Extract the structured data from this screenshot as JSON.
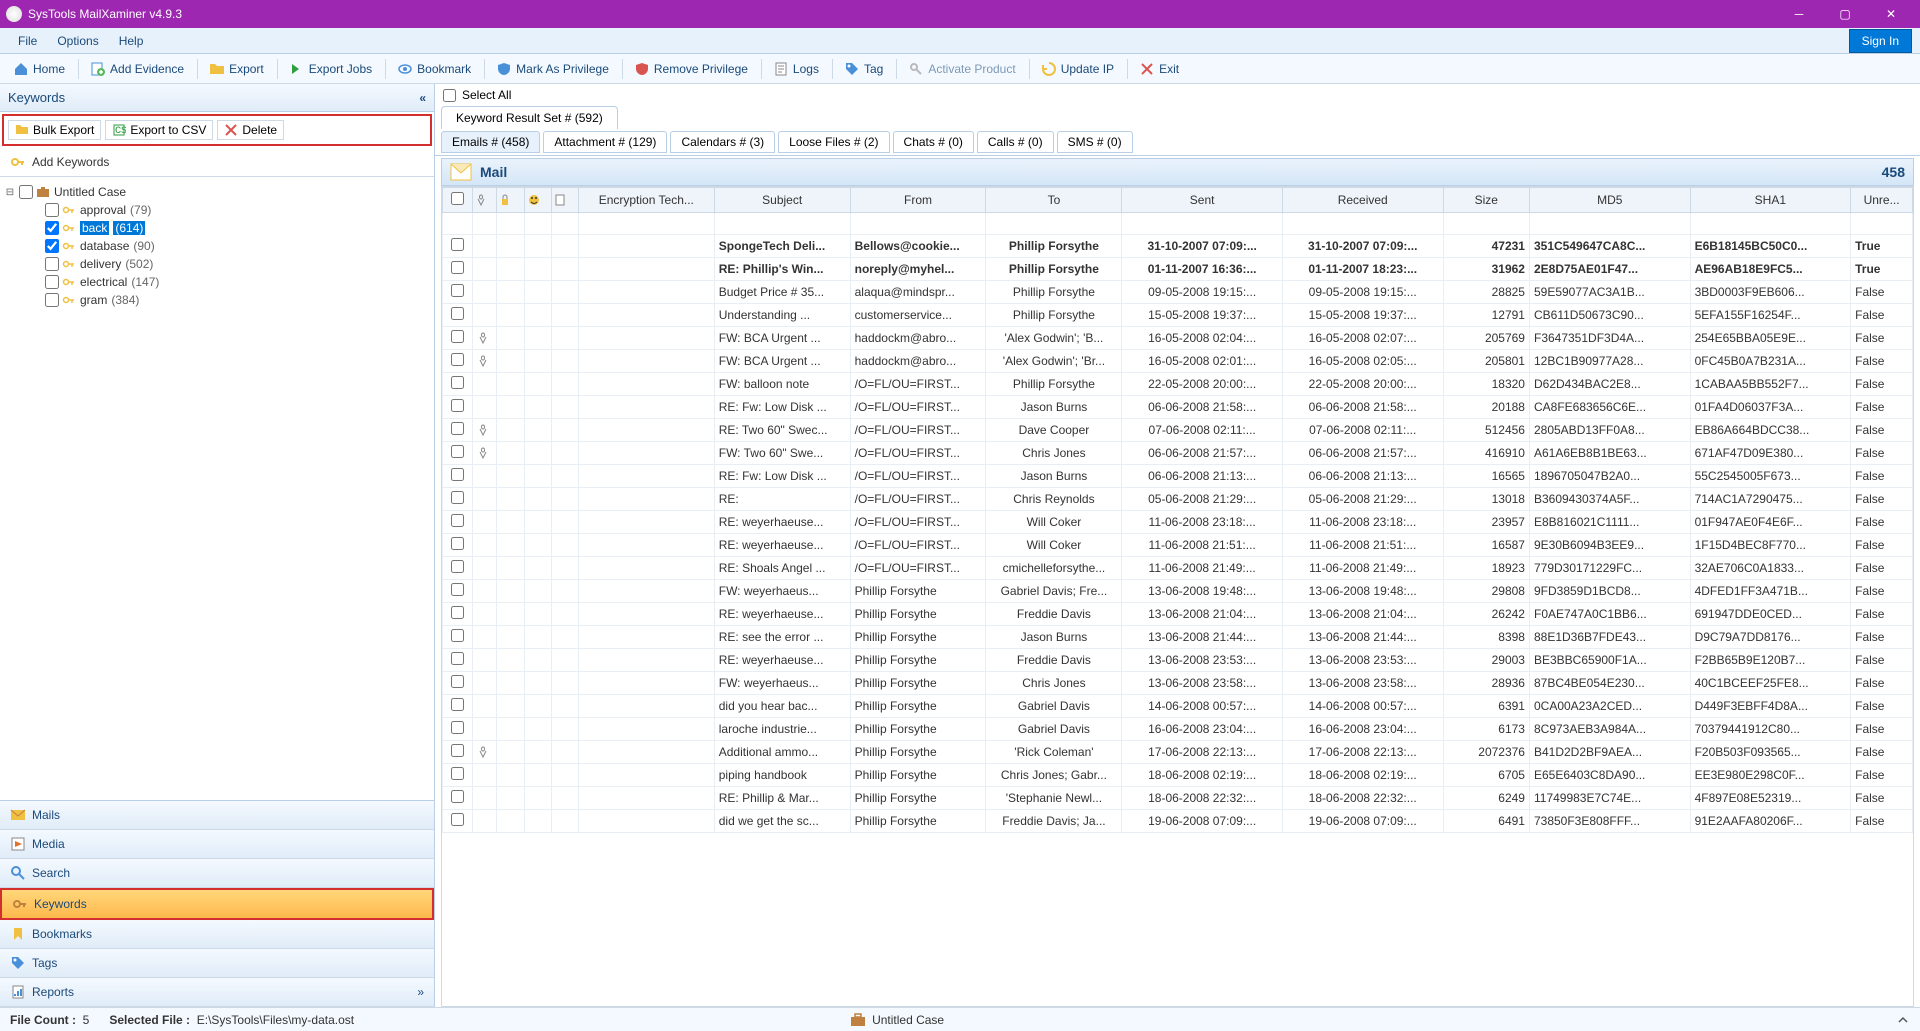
{
  "app": {
    "title": "SysTools MailXaminer v4.9.3"
  },
  "menu": {
    "file": "File",
    "options": "Options",
    "help": "Help",
    "signin": "Sign In"
  },
  "toolbar": {
    "home": "Home",
    "addEvidence": "Add Evidence",
    "export": "Export",
    "exportJobs": "Export Jobs",
    "bookmark": "Bookmark",
    "markPriv": "Mark As Privilege",
    "removePriv": "Remove Privilege",
    "logs": "Logs",
    "tag": "Tag",
    "activate": "Activate Product",
    "updateIp": "Update IP",
    "exit": "Exit"
  },
  "keywordsPanel": {
    "title": "Keywords",
    "bulkExport": "Bulk Export",
    "exportCsv": "Export to CSV",
    "delete": "Delete",
    "addKeywords": "Add Keywords",
    "caseName": "Untitled Case",
    "items": [
      {
        "label": "approval",
        "count": "(79)",
        "checked": false,
        "sel": false
      },
      {
        "label": "back",
        "count": "(614)",
        "checked": true,
        "sel": true
      },
      {
        "label": "database",
        "count": "(90)",
        "checked": true,
        "sel": false
      },
      {
        "label": "delivery",
        "count": "(502)",
        "checked": false,
        "sel": false
      },
      {
        "label": "electrical",
        "count": "(147)",
        "checked": false,
        "sel": false
      },
      {
        "label": "gram",
        "count": "(384)",
        "checked": false,
        "sel": false
      }
    ]
  },
  "nav": {
    "mails": "Mails",
    "media": "Media",
    "search": "Search",
    "keywords": "Keywords",
    "bookmarks": "Bookmarks",
    "tags": "Tags",
    "reports": "Reports"
  },
  "content": {
    "selectAll": "Select All",
    "resultTab": "Keyword Result Set # (592)",
    "subtabs": [
      "Emails # (458)",
      "Attachment # (129)",
      "Calendars # (3)",
      "Loose Files # (2)",
      "Chats # (0)",
      "Calls # (0)",
      "SMS # (0)"
    ],
    "mailLabel": "Mail",
    "mailCount": "458",
    "columns": [
      "",
      "",
      "",
      "",
      "",
      "Encryption Tech...",
      "Subject",
      "From",
      "To",
      "Sent",
      "Received",
      "Size",
      "MD5",
      "SHA1",
      "Unre..."
    ],
    "rows": [
      {
        "att": false,
        "bold": true,
        "subject": "SpongeTech Deli...",
        "from": "Bellows@cookie...",
        "to": "Phillip Forsythe",
        "sent": "31-10-2007 07:09:...",
        "recv": "31-10-2007 07:09:...",
        "size": "47231",
        "md5": "351C549647CA8C...",
        "sha1": "E6B18145BC50C0...",
        "unread": "True"
      },
      {
        "att": false,
        "bold": true,
        "subject": "RE: Phillip's Win...",
        "from": "noreply@myhel...",
        "to": "Phillip Forsythe",
        "sent": "01-11-2007 16:36:...",
        "recv": "01-11-2007 18:23:...",
        "size": "31962",
        "md5": "2E8D75AE01F47...",
        "sha1": "AE96AB18E9FC5...",
        "unread": "True"
      },
      {
        "att": false,
        "bold": false,
        "subject": "Budget Price # 35...",
        "from": "alaqua@mindspr...",
        "to": "Phillip Forsythe",
        "sent": "09-05-2008 19:15:...",
        "recv": "09-05-2008 19:15:...",
        "size": "28825",
        "md5": "59E59077AC3A1B...",
        "sha1": "3BD0003F9EB606...",
        "unread": "False"
      },
      {
        "att": false,
        "bold": false,
        "subject": "Understanding ...",
        "from": "customerservice...",
        "to": "Phillip Forsythe",
        "sent": "15-05-2008 19:37:...",
        "recv": "15-05-2008 19:37:...",
        "size": "12791",
        "md5": "CB611D50673C90...",
        "sha1": "5EFA155F16254F...",
        "unread": "False"
      },
      {
        "att": true,
        "bold": false,
        "subject": "FW: BCA Urgent ...",
        "from": "haddockm@abro...",
        "to": "'Alex Godwin'; 'B...",
        "sent": "16-05-2008 02:04:...",
        "recv": "16-05-2008 02:07:...",
        "size": "205769",
        "md5": "F3647351DF3D4A...",
        "sha1": "254E65BBA05E9E...",
        "unread": "False"
      },
      {
        "att": true,
        "bold": false,
        "subject": "FW: BCA Urgent ...",
        "from": "haddockm@abro...",
        "to": "'Alex Godwin'; 'Br...",
        "sent": "16-05-2008 02:01:...",
        "recv": "16-05-2008 02:05:...",
        "size": "205801",
        "md5": "12BC1B90977A28...",
        "sha1": "0FC45B0A7B231A...",
        "unread": "False"
      },
      {
        "att": false,
        "bold": false,
        "subject": "FW: balloon note",
        "from": "/O=FL/OU=FIRST...",
        "to": "Phillip Forsythe",
        "sent": "22-05-2008 20:00:...",
        "recv": "22-05-2008 20:00:...",
        "size": "18320",
        "md5": "D62D434BAC2E8...",
        "sha1": "1CABAA5BB552F7...",
        "unread": "False"
      },
      {
        "att": false,
        "bold": false,
        "subject": "RE: Fw: Low Disk ...",
        "from": "/O=FL/OU=FIRST...",
        "to": "Jason Burns",
        "sent": "06-06-2008 21:58:...",
        "recv": "06-06-2008 21:58:...",
        "size": "20188",
        "md5": "CA8FE683656C6E...",
        "sha1": "01FA4D06037F3A...",
        "unread": "False"
      },
      {
        "att": true,
        "bold": false,
        "subject": "RE: Two 60\" Swec...",
        "from": "/O=FL/OU=FIRST...",
        "to": "Dave Cooper",
        "sent": "07-06-2008 02:11:...",
        "recv": "07-06-2008 02:11:...",
        "size": "512456",
        "md5": "2805ABD13FF0A8...",
        "sha1": "EB86A664BDCC38...",
        "unread": "False"
      },
      {
        "att": true,
        "bold": false,
        "subject": "FW: Two 60\" Swe...",
        "from": "/O=FL/OU=FIRST...",
        "to": "Chris Jones",
        "sent": "06-06-2008 21:57:...",
        "recv": "06-06-2008 21:57:...",
        "size": "416910",
        "md5": "A61A6EB8B1BE63...",
        "sha1": "671AF47D09E380...",
        "unread": "False"
      },
      {
        "att": false,
        "bold": false,
        "subject": "RE: Fw: Low Disk ...",
        "from": "/O=FL/OU=FIRST...",
        "to": "Jason Burns",
        "sent": "06-06-2008 21:13:...",
        "recv": "06-06-2008 21:13:...",
        "size": "16565",
        "md5": "1896705047B2A0...",
        "sha1": "55C2545005F673...",
        "unread": "False"
      },
      {
        "att": false,
        "bold": false,
        "subject": "RE:",
        "from": "/O=FL/OU=FIRST...",
        "to": "Chris Reynolds",
        "sent": "05-06-2008 21:29:...",
        "recv": "05-06-2008 21:29:...",
        "size": "13018",
        "md5": "B3609430374A5F...",
        "sha1": "714AC1A7290475...",
        "unread": "False"
      },
      {
        "att": false,
        "bold": false,
        "subject": "RE: weyerhaeuse...",
        "from": "/O=FL/OU=FIRST...",
        "to": "Will Coker",
        "sent": "11-06-2008 23:18:...",
        "recv": "11-06-2008 23:18:...",
        "size": "23957",
        "md5": "E8B816021C1111...",
        "sha1": "01F947AE0F4E6F...",
        "unread": "False"
      },
      {
        "att": false,
        "bold": false,
        "subject": "RE: weyerhaeuse...",
        "from": "/O=FL/OU=FIRST...",
        "to": "Will Coker",
        "sent": "11-06-2008 21:51:...",
        "recv": "11-06-2008 21:51:...",
        "size": "16587",
        "md5": "9E30B6094B3EE9...",
        "sha1": "1F15D4BEC8F770...",
        "unread": "False"
      },
      {
        "att": false,
        "bold": false,
        "subject": "RE: Shoals Angel ...",
        "from": "/O=FL/OU=FIRST...",
        "to": "cmichelleforsythe...",
        "sent": "11-06-2008 21:49:...",
        "recv": "11-06-2008 21:49:...",
        "size": "18923",
        "md5": "779D30171229FC...",
        "sha1": "32AE706C0A1833...",
        "unread": "False"
      },
      {
        "att": false,
        "bold": false,
        "subject": "FW: weyerhaeus...",
        "from": "Phillip Forsythe",
        "to": "Gabriel Davis; Fre...",
        "sent": "13-06-2008 19:48:...",
        "recv": "13-06-2008 19:48:...",
        "size": "29808",
        "md5": "9FD3859D1BCD8...",
        "sha1": "4DFED1FF3A471B...",
        "unread": "False"
      },
      {
        "att": false,
        "bold": false,
        "subject": "RE: weyerhaeuse...",
        "from": "Phillip Forsythe",
        "to": "Freddie Davis",
        "sent": "13-06-2008 21:04:...",
        "recv": "13-06-2008 21:04:...",
        "size": "26242",
        "md5": "F0AE747A0C1BB6...",
        "sha1": "691947DDE0CED...",
        "unread": "False"
      },
      {
        "att": false,
        "bold": false,
        "subject": "RE: see the error ...",
        "from": "Phillip Forsythe",
        "to": "Jason Burns",
        "sent": "13-06-2008 21:44:...",
        "recv": "13-06-2008 21:44:...",
        "size": "8398",
        "md5": "88E1D36B7FDE43...",
        "sha1": "D9C79A7DD8176...",
        "unread": "False"
      },
      {
        "att": false,
        "bold": false,
        "subject": "RE: weyerhaeuse...",
        "from": "Phillip Forsythe",
        "to": "Freddie Davis",
        "sent": "13-06-2008 23:53:...",
        "recv": "13-06-2008 23:53:...",
        "size": "29003",
        "md5": "BE3BBC65900F1A...",
        "sha1": "F2BB65B9E120B7...",
        "unread": "False"
      },
      {
        "att": false,
        "bold": false,
        "subject": "FW: weyerhaeus...",
        "from": "Phillip Forsythe",
        "to": "Chris Jones",
        "sent": "13-06-2008 23:58:...",
        "recv": "13-06-2008 23:58:...",
        "size": "28936",
        "md5": "87BC4BE054E230...",
        "sha1": "40C1BCEEF25FE8...",
        "unread": "False"
      },
      {
        "att": false,
        "bold": false,
        "subject": "did you hear bac...",
        "from": "Phillip Forsythe",
        "to": "Gabriel Davis",
        "sent": "14-06-2008 00:57:...",
        "recv": "14-06-2008 00:57:...",
        "size": "6391",
        "md5": "0CA00A23A2CED...",
        "sha1": "D449F3EBFF4D8A...",
        "unread": "False"
      },
      {
        "att": false,
        "bold": false,
        "subject": "laroche industrie...",
        "from": "Phillip Forsythe",
        "to": "Gabriel Davis",
        "sent": "16-06-2008 23:04:...",
        "recv": "16-06-2008 23:04:...",
        "size": "6173",
        "md5": "8C973AEB3A984A...",
        "sha1": "70379441912C80...",
        "unread": "False"
      },
      {
        "att": true,
        "bold": false,
        "subject": "Additional ammo...",
        "from": "Phillip Forsythe",
        "to": "'Rick Coleman'",
        "sent": "17-06-2008 22:13:...",
        "recv": "17-06-2008 22:13:...",
        "size": "2072376",
        "md5": "B41D2D2BF9AEA...",
        "sha1": "F20B503F093565...",
        "unread": "False"
      },
      {
        "att": false,
        "bold": false,
        "subject": "piping handbook",
        "from": "Phillip Forsythe",
        "to": "Chris Jones; Gabr...",
        "sent": "18-06-2008 02:19:...",
        "recv": "18-06-2008 02:19:...",
        "size": "6705",
        "md5": "E65E6403C8DA90...",
        "sha1": "EE3E980E298C0F...",
        "unread": "False"
      },
      {
        "att": false,
        "bold": false,
        "subject": "RE: Phillip & Mar...",
        "from": "Phillip Forsythe",
        "to": "'Stephanie Newl...",
        "sent": "18-06-2008 22:32:...",
        "recv": "18-06-2008 22:32:...",
        "size": "6249",
        "md5": "11749983E7C74E...",
        "sha1": "4F897E08E52319...",
        "unread": "False"
      },
      {
        "att": false,
        "bold": false,
        "subject": "did we get the sc...",
        "from": "Phillip Forsythe",
        "to": "Freddie Davis; Ja...",
        "sent": "19-06-2008 07:09:...",
        "recv": "19-06-2008 07:09:...",
        "size": "6491",
        "md5": "73850F3E808FFF...",
        "sha1": "91E2AAFA80206F...",
        "unread": "False"
      }
    ]
  },
  "status": {
    "fileCountLabel": "File Count :",
    "fileCount": "5",
    "selFileLabel": "Selected File :",
    "selFile": "E:\\SysTools\\Files\\my-data.ost",
    "caseName": "Untitled Case"
  }
}
